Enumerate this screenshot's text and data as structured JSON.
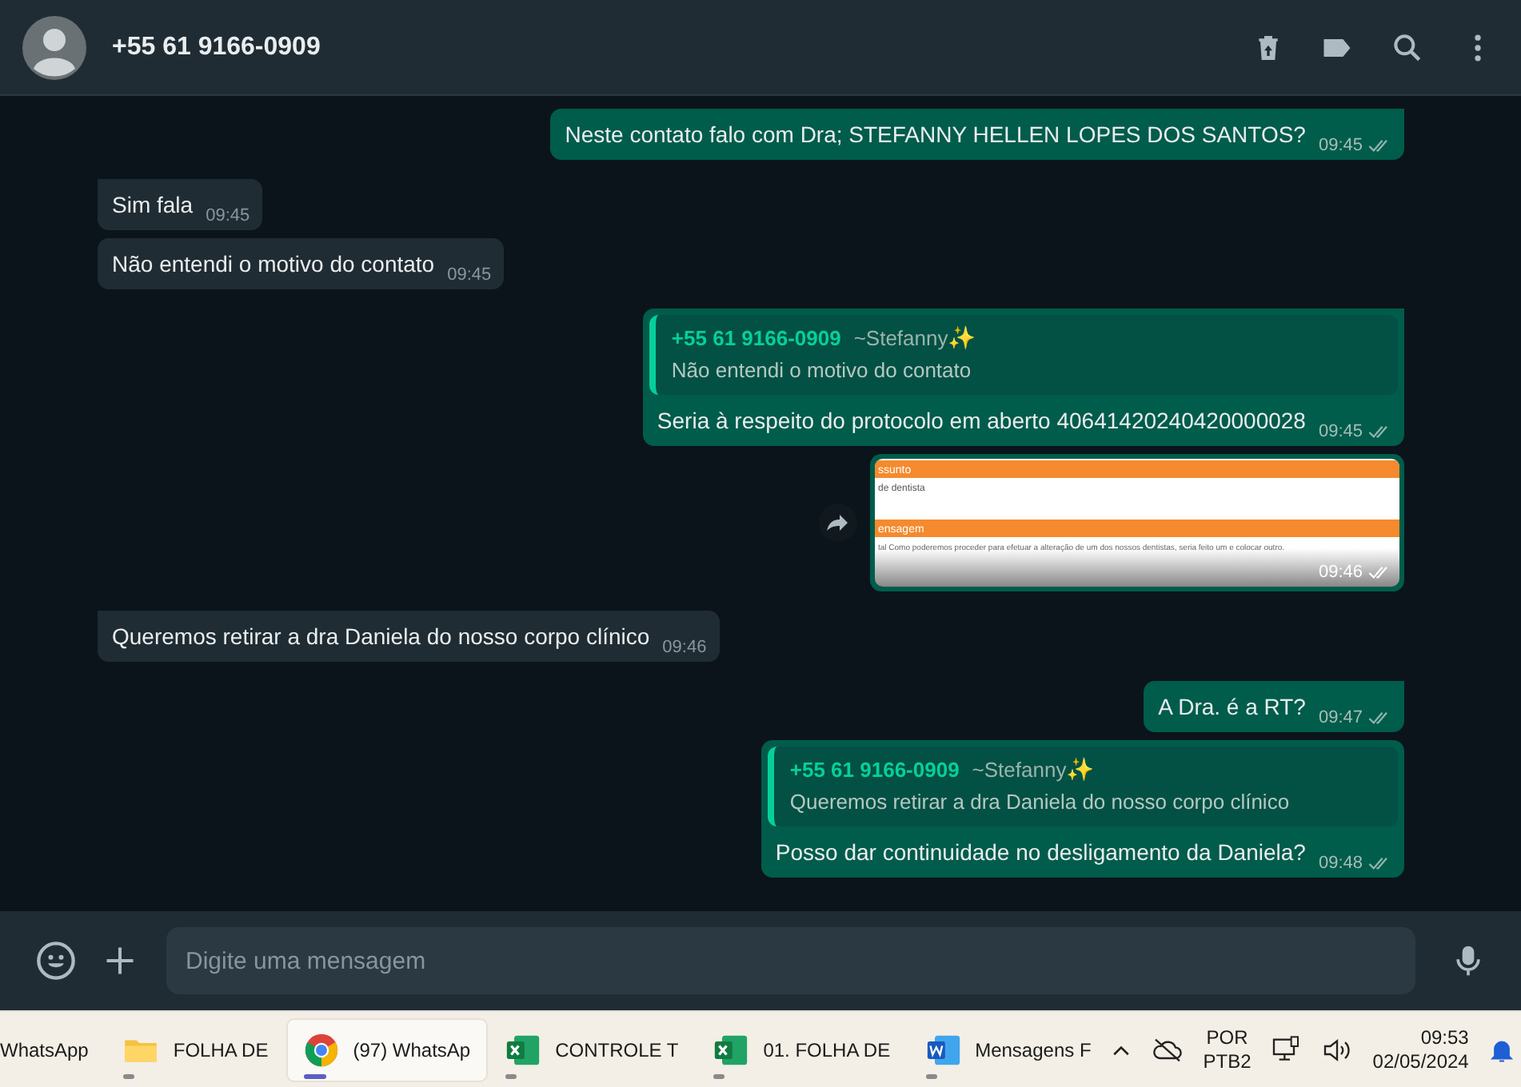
{
  "header": {
    "title": "+55 61 9166-0909"
  },
  "messages": [
    {
      "kind": "outgoing",
      "tail": true,
      "text": "Neste contato falo com Dra; STEFANNY HELLEN LOPES DOS SANTOS?",
      "time": "09:45"
    },
    {
      "kind": "incoming",
      "tail": true,
      "text": "Sim fala",
      "time": "09:45"
    },
    {
      "kind": "incoming",
      "tail": false,
      "text": "Não entendi o motivo do contato",
      "time": "09:45"
    },
    {
      "kind": "outgoing",
      "tail": true,
      "quote": {
        "author": "+55 61 9166-0909",
        "name": "~Stefanny",
        "emoji": "✨",
        "text": "Não entendi o motivo do contato"
      },
      "text": "Seria à respeito do protocolo em aberto 40641420240420000028",
      "time": "09:45"
    },
    {
      "kind": "image",
      "tail": false,
      "image": {
        "heading_1": "ssunto",
        "line_1": "de dentista",
        "heading_2": "ensagem",
        "line_2": "tal Como poderemos proceder para efetuar a alteração de um dos nossos dentistas, seria feito um e colocar outro."
      },
      "time": "09:46"
    },
    {
      "kind": "incoming",
      "tail": true,
      "text": "Queremos retirar a dra Daniela do nosso corpo clínico",
      "time": "09:46"
    },
    {
      "kind": "outgoing",
      "tail": true,
      "text": "A Dra. é a RT?",
      "time": "09:47"
    },
    {
      "kind": "outgoing",
      "tail": false,
      "quote": {
        "author": "+55 61 9166-0909",
        "name": "~Stefanny",
        "emoji": "✨",
        "text": "Queremos retirar a dra Daniela do nosso corpo clínico"
      },
      "text": "Posso dar continuidade no desligamento da Daniela?",
      "time": "09:48"
    }
  ],
  "composer": {
    "placeholder": "Digite uma mensagem"
  },
  "taskbar": {
    "apps": [
      {
        "kind": "none",
        "label": "WhatsApp",
        "selected": false,
        "running": false
      },
      {
        "kind": "folder",
        "label": "FOLHA DE",
        "selected": false,
        "running": true
      },
      {
        "kind": "browser",
        "label": "(97) WhatsAp",
        "selected": true,
        "running": true
      },
      {
        "kind": "excel",
        "label": "CONTROLE T",
        "selected": false,
        "running": true
      },
      {
        "kind": "excel",
        "label": "01. FOLHA DE",
        "selected": false,
        "running": true
      },
      {
        "kind": "word",
        "label": "Mensagens F",
        "selected": false,
        "running": true
      }
    ],
    "language": "POR",
    "layout": "PTB2",
    "time": "09:53",
    "date": "02/05/2024"
  }
}
